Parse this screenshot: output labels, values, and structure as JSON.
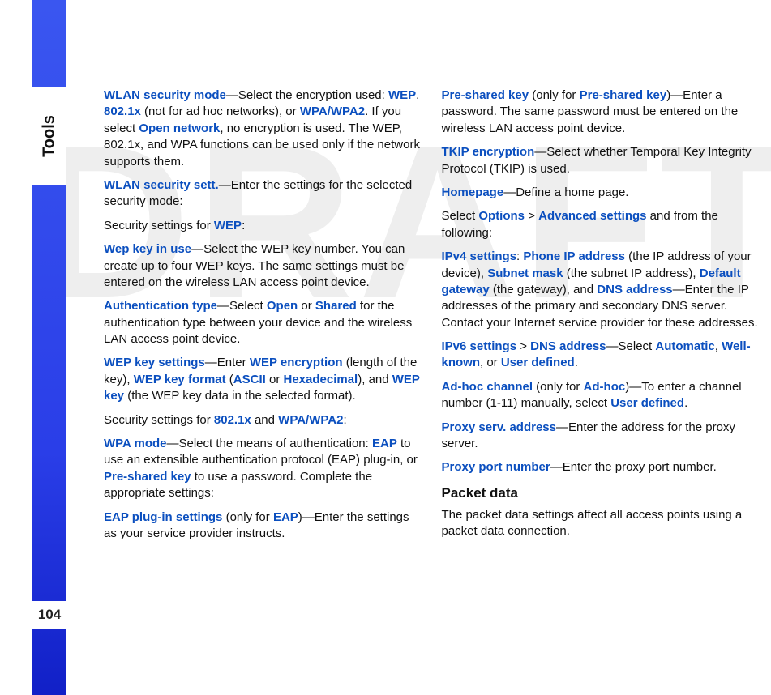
{
  "watermark": "DRAFT",
  "section_label": "Tools",
  "page_number": "104",
  "left": {
    "p1": {
      "t1": "WLAN security mode",
      "t2": "—Select the encryption used: ",
      "t3": "WEP",
      "t4": ", ",
      "t5": "802.1x",
      "t6": " (not for ad hoc networks), or ",
      "t7": "WPA/WPA2",
      "t8": ". If you select ",
      "t9": "Open network",
      "t10": ", no encryption is used. The WEP, 802.1x, and WPA functions can be used only if the network supports them."
    },
    "p2": {
      "t1": "WLAN security sett.",
      "t2": "—Enter the settings for the selected security mode:"
    },
    "p3": {
      "t1": "Security settings for ",
      "t2": "WEP",
      "t3": ":"
    },
    "p4": {
      "t1": "Wep key in use",
      "t2": "—Select the WEP key number. You can create up to four WEP keys. The same settings must be entered on the wireless LAN access point device."
    },
    "p5": {
      "t1": "Authentication type",
      "t2": "—Select ",
      "t3": "Open",
      "t4": " or ",
      "t5": "Shared",
      "t6": " for the authentication type between your device and the wireless LAN access point device."
    },
    "p6": {
      "t1": "WEP key settings",
      "t2": "—Enter ",
      "t3": "WEP encryption",
      "t4": " (length of the key), ",
      "t5": "WEP key format",
      "t6": " (",
      "t7": "ASCII",
      "t8": " or ",
      "t9": "Hexadecimal",
      "t10": "), and ",
      "t11": "WEP key",
      "t12": " (the WEP key data in the selected format)."
    },
    "p7": {
      "t1": "Security settings for ",
      "t2": "802.1x",
      "t3": " and ",
      "t4": "WPA/WPA2",
      "t5": ":"
    },
    "p8": {
      "t1": "WPA mode",
      "t2": "—Select the means of authentication: ",
      "t3": "EAP",
      "t4": " to use an extensible authentication protocol (EAP) plug-in, or ",
      "t5": "Pre-shared key",
      "t6": " to use a password. Complete the appropriate settings:"
    },
    "p9": {
      "t1": "EAP plug-in settings",
      "t2": " (only for ",
      "t3": "EAP",
      "t4": ")—Enter the settings as your service provider instructs."
    }
  },
  "right": {
    "p1": {
      "t1": "Pre-shared key",
      "t2": " (only for ",
      "t3": "Pre-shared key",
      "t4": ")—Enter a password. The same password must be entered on the wireless LAN access point device."
    },
    "p2": {
      "t1": "TKIP encryption",
      "t2": "—Select whether Temporal Key Integrity Protocol (TKIP) is used."
    },
    "p3": {
      "t1": "Homepage",
      "t2": "—Define a home page."
    },
    "p4": {
      "t1": "Select ",
      "t2": "Options",
      "t3": " > ",
      "t4": "Advanced settings",
      "t5": " and from the following:"
    },
    "p5": {
      "t1": "IPv4 settings",
      "t2": ": ",
      "t3": "Phone IP address",
      "t4": " (the IP address of your device), ",
      "t5": "Subnet mask",
      "t6": " (the subnet IP address), ",
      "t7": "Default gateway",
      "t8": " (the gateway), and ",
      "t9": "DNS address",
      "t10": "—Enter the IP addresses of the primary and secondary DNS server. Contact your Internet service provider for these addresses."
    },
    "p6": {
      "t1": "IPv6 settings",
      "t2": " > ",
      "t3": "DNS address",
      "t4": "—Select ",
      "t5": "Automatic",
      "t6": ", ",
      "t7": "Well-known",
      "t8": ", or ",
      "t9": "User defined",
      "t10": "."
    },
    "p7": {
      "t1": "Ad-hoc channel",
      "t2": " (only for ",
      "t3": "Ad-hoc",
      "t4": ")—To enter a channel number (1-11) manually, select ",
      "t5": "User defined",
      "t6": "."
    },
    "p8": {
      "t1": "Proxy serv. address",
      "t2": "—Enter the address for the proxy server."
    },
    "p9": {
      "t1": "Proxy port number",
      "t2": "—Enter the proxy port number."
    },
    "h1": "Packet data",
    "p10": {
      "t1": "The packet data settings affect all access points using a packet data connection."
    }
  }
}
